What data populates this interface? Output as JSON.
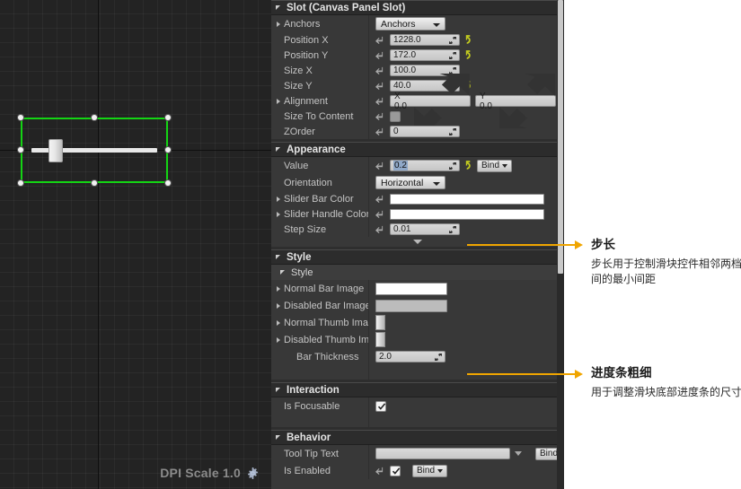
{
  "viewport": {
    "dpi_scale_label": "DPI Scale 1.0",
    "gear_icon": "gear-icon",
    "widget": "slider-preview"
  },
  "details": {
    "sections": [
      {
        "id": "slot",
        "title": "Slot (Canvas Panel Slot)",
        "rows": [
          {
            "label": "Anchors",
            "type": "combo",
            "value": "Anchors",
            "expandable": true
          },
          {
            "label": "Position X",
            "type": "number",
            "value": "1228.0",
            "revert": true,
            "pin": true
          },
          {
            "label": "Position Y",
            "type": "number",
            "value": "172.0",
            "revert": true,
            "pin": true
          },
          {
            "label": "Size X",
            "type": "number",
            "value": "100.0",
            "revert": false,
            "pin": true
          },
          {
            "label": "Size Y",
            "type": "number",
            "value": "40.0",
            "revert": true,
            "pin": true
          },
          {
            "label": "Alignment",
            "type": "vector",
            "value_x": "X  0.0",
            "value_y": "Y  0.0",
            "expandable": true,
            "pin": true
          },
          {
            "label": "Size To Content",
            "type": "checkbox",
            "checked": false,
            "pin": true
          },
          {
            "label": "ZOrder",
            "type": "number",
            "value": "0",
            "pin": true
          }
        ]
      },
      {
        "id": "appearance",
        "title": "Appearance",
        "rows": [
          {
            "label": "Value",
            "type": "number",
            "value": "0.2",
            "selected": true,
            "revert": true,
            "bind": "Bind",
            "pin": true
          },
          {
            "label": "Orientation",
            "type": "combo",
            "value": "Horizontal"
          },
          {
            "label": "Slider Bar Color",
            "type": "color",
            "swatch": "white",
            "expandable": true,
            "pin": true
          },
          {
            "label": "Slider Handle Color",
            "type": "color",
            "swatch": "white",
            "expandable": true,
            "pin": true
          },
          {
            "label": "Step Size",
            "type": "number",
            "value": "0.01",
            "pin": true
          }
        ],
        "has_more_toggle": true
      },
      {
        "id": "style",
        "title": "Style",
        "sub_title": "Style",
        "rows": [
          {
            "label": "Normal Bar Image",
            "type": "image",
            "swatch": "white",
            "expandable": true
          },
          {
            "label": "Disabled Bar Image",
            "type": "image",
            "swatch": "grey",
            "expandable": true
          },
          {
            "label": "Normal Thumb Image",
            "type": "thumb",
            "expandable": true
          },
          {
            "label": "Disabled Thumb Image",
            "type": "thumb",
            "expandable": true
          },
          {
            "label": "Bar Thickness",
            "type": "number",
            "value": "2.0"
          }
        ]
      },
      {
        "id": "interaction",
        "title": "Interaction",
        "rows": [
          {
            "label": "Is Focusable",
            "type": "checkbox",
            "checked": true
          }
        ]
      },
      {
        "id": "behavior",
        "title": "Behavior",
        "rows": [
          {
            "label": "Tool Tip Text",
            "type": "text",
            "value": "",
            "dropdown": true,
            "bind": "Bind"
          },
          {
            "label": "Is Enabled",
            "type": "checkbox",
            "checked": true,
            "bind": "Bind",
            "pin": true
          }
        ]
      }
    ]
  },
  "annotations": [
    {
      "id": "step-size",
      "title": "步长",
      "body": "步长用于控制滑块控件相邻两档之间的最小间距"
    },
    {
      "id": "bar-thickness",
      "title": "进度条粗细",
      "body": "用于调整滑块底部进度条的尺寸"
    }
  ],
  "colors": {
    "accent": "#f0a500",
    "selection": "#14d414",
    "panel_bg": "#383838",
    "header_bg": "#2c2c2c"
  }
}
